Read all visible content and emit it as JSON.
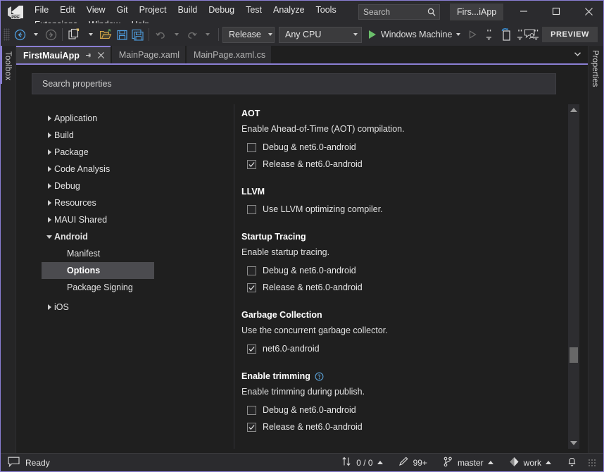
{
  "titlebar": {
    "logo_icon": "visual-studio-preview-logo",
    "menus": [
      "File",
      "Edit",
      "View",
      "Git",
      "Project",
      "Build",
      "Debug",
      "Test",
      "Analyze",
      "Tools",
      "Extensions",
      "Window",
      "Help"
    ],
    "search": {
      "placeholder": "Search",
      "icon": "search-icon"
    },
    "project_chip": "Firs...iApp",
    "window_controls": {
      "minimize": "minimize-icon",
      "maximize": "maximize-icon",
      "close": "close-icon"
    }
  },
  "toolbar": {
    "nav_back": "navigate-back-icon",
    "nav_forward": "navigate-forward-icon",
    "new_item": "new-item-icon",
    "open_file": "open-file-icon",
    "save": "save-icon",
    "save_all": "save-all-icon",
    "undo": "undo-icon",
    "redo": "redo-icon",
    "configuration": "Release",
    "platform": "Any CPU",
    "run_target": "Windows Machine",
    "run_icon": "play-icon",
    "attach_icon": "play-outline-icon",
    "hot_reload_icon": "hot-reload-icon",
    "live_preview_left_icon": "live-visual-tree-icon",
    "live_preview_right_icon": "live-property-explorer-icon",
    "feedback_icon": "send-feedback-icon",
    "preview_badge": "PREVIEW"
  },
  "docarea": {
    "toolbox_label": "Toolbox",
    "properties_label": "Properties",
    "tabs": [
      {
        "label": "FirstMauiApp",
        "active": true,
        "pin_icon": "pin-icon",
        "close_icon": "close-tab-icon"
      },
      {
        "label": "MainPage.xaml",
        "active": false
      },
      {
        "label": "MainPage.xaml.cs",
        "active": false
      }
    ],
    "tab_overflow_icon": "chevron-down-icon",
    "tab_settings_icon": "gear-icon"
  },
  "properties_page": {
    "search": {
      "placeholder": "Search properties",
      "value": ""
    },
    "tree": [
      {
        "label": "Application",
        "level": 0,
        "state": "collapsed"
      },
      {
        "label": "Build",
        "level": 0,
        "state": "collapsed"
      },
      {
        "label": "Package",
        "level": 0,
        "state": "collapsed"
      },
      {
        "label": "Code Analysis",
        "level": 0,
        "state": "collapsed"
      },
      {
        "label": "Debug",
        "level": 0,
        "state": "collapsed"
      },
      {
        "label": "Resources",
        "level": 0,
        "state": "collapsed"
      },
      {
        "label": "MAUI Shared",
        "level": 0,
        "state": "collapsed"
      },
      {
        "label": "Android",
        "level": 0,
        "state": "expanded"
      },
      {
        "label": "Manifest",
        "level": 1,
        "state": "leaf"
      },
      {
        "label": "Options",
        "level": 1,
        "state": "leaf",
        "selected": true
      },
      {
        "label": "Package Signing",
        "level": 1,
        "state": "leaf"
      },
      {
        "label": "iOS",
        "level": 0,
        "state": "collapsed"
      }
    ],
    "sections": [
      {
        "title": "AOT",
        "description": "Enable Ahead-of-Time (AOT) compilation.",
        "help_icon": null,
        "options": [
          {
            "label": "Debug & net6.0-android",
            "checked": false
          },
          {
            "label": "Release & net6.0-android",
            "checked": true
          }
        ]
      },
      {
        "title": "LLVM",
        "description": null,
        "help_icon": null,
        "options": [
          {
            "label": "Use LLVM optimizing compiler.",
            "checked": false
          }
        ]
      },
      {
        "title": "Startup Tracing",
        "description": "Enable startup tracing.",
        "help_icon": null,
        "options": [
          {
            "label": "Debug & net6.0-android",
            "checked": false
          },
          {
            "label": "Release & net6.0-android",
            "checked": true
          }
        ]
      },
      {
        "title": "Garbage Collection",
        "description": "Use the concurrent garbage collector.",
        "help_icon": null,
        "options": [
          {
            "label": "net6.0-android",
            "checked": true
          }
        ]
      },
      {
        "title": "Enable trimming",
        "description": "Enable trimming during publish.",
        "help_icon": "help-icon",
        "options": [
          {
            "label": "Debug & net6.0-android",
            "checked": false
          },
          {
            "label": "Release & net6.0-android",
            "checked": true
          }
        ]
      }
    ],
    "scrollbar": {
      "up_icon": "scroll-up-icon",
      "down_icon": "scroll-down-icon"
    }
  },
  "statusbar": {
    "status_icon": "ready-icon",
    "status_text": "Ready",
    "source_control_sync": {
      "icon": "up-down-arrows-icon",
      "text": "0 / 0",
      "caret": "caret-up-icon"
    },
    "pending_changes": {
      "icon": "pencil-icon",
      "text": "99+"
    },
    "branch": {
      "icon": "branch-icon",
      "text": "master",
      "caret": "caret-up-icon"
    },
    "repository": {
      "icon": "repo-icon",
      "text": "work",
      "caret": "caret-up-icon"
    },
    "notifications_icon": "bell-icon",
    "resize_grip_icon": "resize-grip-icon"
  },
  "colors": {
    "accent": "#8b7fd4",
    "chrome": "#2b2b2e",
    "editor_bg": "#1f1f1f",
    "play_green": "#6bbf6b",
    "hot_reload_blue": "#3b8fd4"
  }
}
